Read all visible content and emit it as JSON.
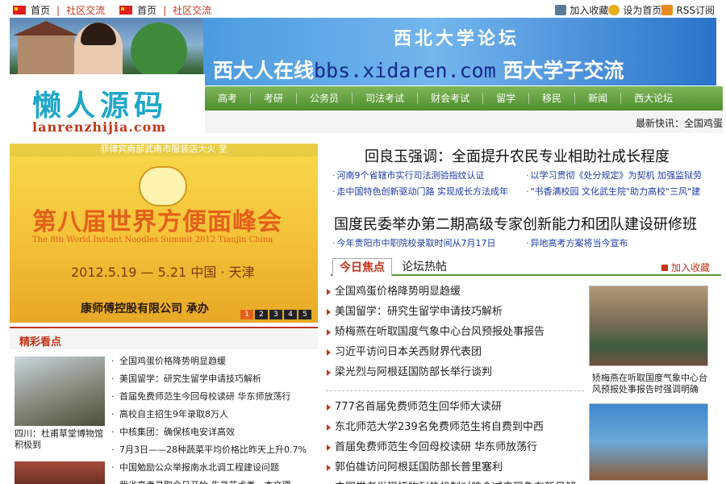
{
  "topbar": {
    "left": [
      "首页",
      "社区交流",
      "首页",
      "社区交流"
    ],
    "right": {
      "fav": "加入收藏",
      "home": "设为首页",
      "rss": "RSS订阅"
    }
  },
  "banner": {
    "title": "西北大学论坛",
    "sub_left": "西大人在线",
    "sub_url": "bbs.xidaren.com",
    "sub_right": "西大学子交流"
  },
  "logo": {
    "cn": "懒人源码",
    "en": "lanrenzhijia.com"
  },
  "nav": [
    "高考",
    "考研",
    "公务员",
    "司法考试",
    "财会考试",
    "留学",
    "移民",
    "新闻",
    "西大论坛"
  ],
  "ticker": "最新快讯：全国鸡蛋",
  "slide": {
    "top_text": "菲律宾南部武南市服装店大火 至",
    "title": "第八届世界方便面峰会",
    "subtitle_en": "The 8th World Instant Noodles Summit 2012   Tianjin China",
    "date": "2012.5.19 — 5.21   中国 · 天津",
    "company": "康师傅控股有限公司 承办",
    "dots": [
      "1",
      "2",
      "3",
      "4",
      "5"
    ]
  },
  "jingcai": {
    "title": "精彩看点",
    "pic1_caption": "四川：杜甫草堂博物馆积极到",
    "list": [
      "全国鸡蛋价格降势明显趋缓",
      "美国留学：研究生留学申请技巧解析",
      "首届免费师范生今回母校读研 华东师放荡行",
      "高校自主招生9年录取8万人",
      "中核集团：确保核电安详高效",
      "7月3日——28种蔬菜平均价格比昨天上升0.7%",
      "中国勉励公众举报南水北调工程建设问题",
      "我省高考录取今日开始 先录艺术类一本文理"
    ]
  },
  "right": {
    "head1": "回良玉强调：全面提升农民专业相助社成长程度",
    "sub1": [
      "河南9个省辖市实行司法测验指纹认证",
      "以学习贯彻《处分规定》为契机 加强监狱劳"
    ],
    "sub2": [
      "走中国特色创新驱动门路 实现成长方法成年",
      "\"书香满校园 文化武生院\"助力高校\"三风\"建"
    ],
    "head2": "国度民委举办第二期高级专家创新能力和团队建设研修班",
    "sub3": [
      "今年贵阳市中职院校录取时间从7月17日",
      "异地高考方案将当今宣布"
    ]
  },
  "tabs": {
    "active": "今日焦点",
    "other": "论坛热帖",
    "add_fav": "加入收藏"
  },
  "news1": [
    "全国鸡蛋价格降势明显趋缓",
    "美国留学：研究生留学申请技巧解析",
    "矫梅燕在听取国度气象中心台风预报处事报告",
    "习近平访问日本关西财界代表团",
    "梁光烈与阿根廷国防部长举行谈判"
  ],
  "news2": [
    "777名首届免费师范生回华师大读研",
    "东北师范大学239名免费师范生将自费到中西",
    "首届免费师范生今回母校读研 华东师放荡行",
    "郭伯雄访问阿根廷国防部长普里塞利",
    "中国学者发现植物耐热机制对粮食减产现象有新见解"
  ],
  "pic_caption": "矫梅燕在听取国度气象中心台风预报处事报告时强调明确"
}
